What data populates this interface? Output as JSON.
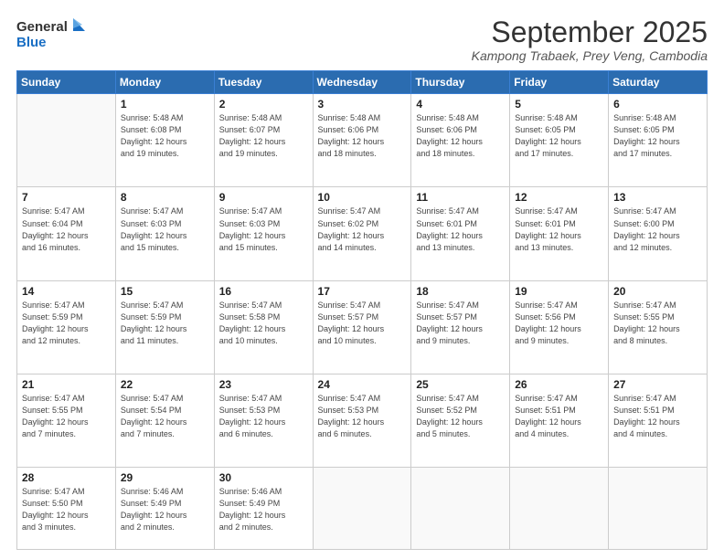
{
  "logo": {
    "line1": "General",
    "line2": "Blue",
    "icon_color": "#1a6fc4"
  },
  "header": {
    "month_year": "September 2025",
    "location": "Kampong Trabaek, Prey Veng, Cambodia"
  },
  "weekdays": [
    "Sunday",
    "Monday",
    "Tuesday",
    "Wednesday",
    "Thursday",
    "Friday",
    "Saturday"
  ],
  "weeks": [
    [
      {
        "day": "",
        "info": ""
      },
      {
        "day": "1",
        "info": "Sunrise: 5:48 AM\nSunset: 6:08 PM\nDaylight: 12 hours\nand 19 minutes."
      },
      {
        "day": "2",
        "info": "Sunrise: 5:48 AM\nSunset: 6:07 PM\nDaylight: 12 hours\nand 19 minutes."
      },
      {
        "day": "3",
        "info": "Sunrise: 5:48 AM\nSunset: 6:06 PM\nDaylight: 12 hours\nand 18 minutes."
      },
      {
        "day": "4",
        "info": "Sunrise: 5:48 AM\nSunset: 6:06 PM\nDaylight: 12 hours\nand 18 minutes."
      },
      {
        "day": "5",
        "info": "Sunrise: 5:48 AM\nSunset: 6:05 PM\nDaylight: 12 hours\nand 17 minutes."
      },
      {
        "day": "6",
        "info": "Sunrise: 5:48 AM\nSunset: 6:05 PM\nDaylight: 12 hours\nand 17 minutes."
      }
    ],
    [
      {
        "day": "7",
        "info": "Sunrise: 5:47 AM\nSunset: 6:04 PM\nDaylight: 12 hours\nand 16 minutes."
      },
      {
        "day": "8",
        "info": "Sunrise: 5:47 AM\nSunset: 6:03 PM\nDaylight: 12 hours\nand 15 minutes."
      },
      {
        "day": "9",
        "info": "Sunrise: 5:47 AM\nSunset: 6:03 PM\nDaylight: 12 hours\nand 15 minutes."
      },
      {
        "day": "10",
        "info": "Sunrise: 5:47 AM\nSunset: 6:02 PM\nDaylight: 12 hours\nand 14 minutes."
      },
      {
        "day": "11",
        "info": "Sunrise: 5:47 AM\nSunset: 6:01 PM\nDaylight: 12 hours\nand 13 minutes."
      },
      {
        "day": "12",
        "info": "Sunrise: 5:47 AM\nSunset: 6:01 PM\nDaylight: 12 hours\nand 13 minutes."
      },
      {
        "day": "13",
        "info": "Sunrise: 5:47 AM\nSunset: 6:00 PM\nDaylight: 12 hours\nand 12 minutes."
      }
    ],
    [
      {
        "day": "14",
        "info": "Sunrise: 5:47 AM\nSunset: 5:59 PM\nDaylight: 12 hours\nand 12 minutes."
      },
      {
        "day": "15",
        "info": "Sunrise: 5:47 AM\nSunset: 5:59 PM\nDaylight: 12 hours\nand 11 minutes."
      },
      {
        "day": "16",
        "info": "Sunrise: 5:47 AM\nSunset: 5:58 PM\nDaylight: 12 hours\nand 10 minutes."
      },
      {
        "day": "17",
        "info": "Sunrise: 5:47 AM\nSunset: 5:57 PM\nDaylight: 12 hours\nand 10 minutes."
      },
      {
        "day": "18",
        "info": "Sunrise: 5:47 AM\nSunset: 5:57 PM\nDaylight: 12 hours\nand 9 minutes."
      },
      {
        "day": "19",
        "info": "Sunrise: 5:47 AM\nSunset: 5:56 PM\nDaylight: 12 hours\nand 9 minutes."
      },
      {
        "day": "20",
        "info": "Sunrise: 5:47 AM\nSunset: 5:55 PM\nDaylight: 12 hours\nand 8 minutes."
      }
    ],
    [
      {
        "day": "21",
        "info": "Sunrise: 5:47 AM\nSunset: 5:55 PM\nDaylight: 12 hours\nand 7 minutes."
      },
      {
        "day": "22",
        "info": "Sunrise: 5:47 AM\nSunset: 5:54 PM\nDaylight: 12 hours\nand 7 minutes."
      },
      {
        "day": "23",
        "info": "Sunrise: 5:47 AM\nSunset: 5:53 PM\nDaylight: 12 hours\nand 6 minutes."
      },
      {
        "day": "24",
        "info": "Sunrise: 5:47 AM\nSunset: 5:53 PM\nDaylight: 12 hours\nand 6 minutes."
      },
      {
        "day": "25",
        "info": "Sunrise: 5:47 AM\nSunset: 5:52 PM\nDaylight: 12 hours\nand 5 minutes."
      },
      {
        "day": "26",
        "info": "Sunrise: 5:47 AM\nSunset: 5:51 PM\nDaylight: 12 hours\nand 4 minutes."
      },
      {
        "day": "27",
        "info": "Sunrise: 5:47 AM\nSunset: 5:51 PM\nDaylight: 12 hours\nand 4 minutes."
      }
    ],
    [
      {
        "day": "28",
        "info": "Sunrise: 5:47 AM\nSunset: 5:50 PM\nDaylight: 12 hours\nand 3 minutes."
      },
      {
        "day": "29",
        "info": "Sunrise: 5:46 AM\nSunset: 5:49 PM\nDaylight: 12 hours\nand 2 minutes."
      },
      {
        "day": "30",
        "info": "Sunrise: 5:46 AM\nSunset: 5:49 PM\nDaylight: 12 hours\nand 2 minutes."
      },
      {
        "day": "",
        "info": ""
      },
      {
        "day": "",
        "info": ""
      },
      {
        "day": "",
        "info": ""
      },
      {
        "day": "",
        "info": ""
      }
    ]
  ]
}
